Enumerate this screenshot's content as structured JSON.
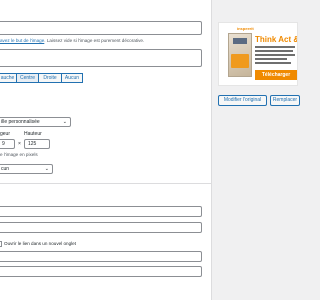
{
  "alt": {
    "help_link": "avez le but de l'image",
    "help_rest": ". Laissez vide si l'image est purement décorative."
  },
  "alignment": {
    "buttons": [
      {
        "label": "auche",
        "active": false
      },
      {
        "label": "Centre",
        "active": true
      },
      {
        "label": "Droite",
        "active": false
      },
      {
        "label": "Aucun",
        "active": false
      }
    ]
  },
  "size": {
    "select_value": "ille personnalisée",
    "width_label": "geur",
    "height_label": "Hauteur",
    "width_value": "9",
    "height_value": "125",
    "separator": "×",
    "unit_help": "e l'image en pixels"
  },
  "link": {
    "select_value": "cun",
    "new_tab_label": "Ouvrir le lien dans un nouvel onglet"
  },
  "ad": {
    "brand": "inspeerit",
    "title": "Think Act &",
    "cta": "Télécharger"
  },
  "actions": {
    "edit_original": "Modifier l'original",
    "replace": "Remplacer"
  }
}
